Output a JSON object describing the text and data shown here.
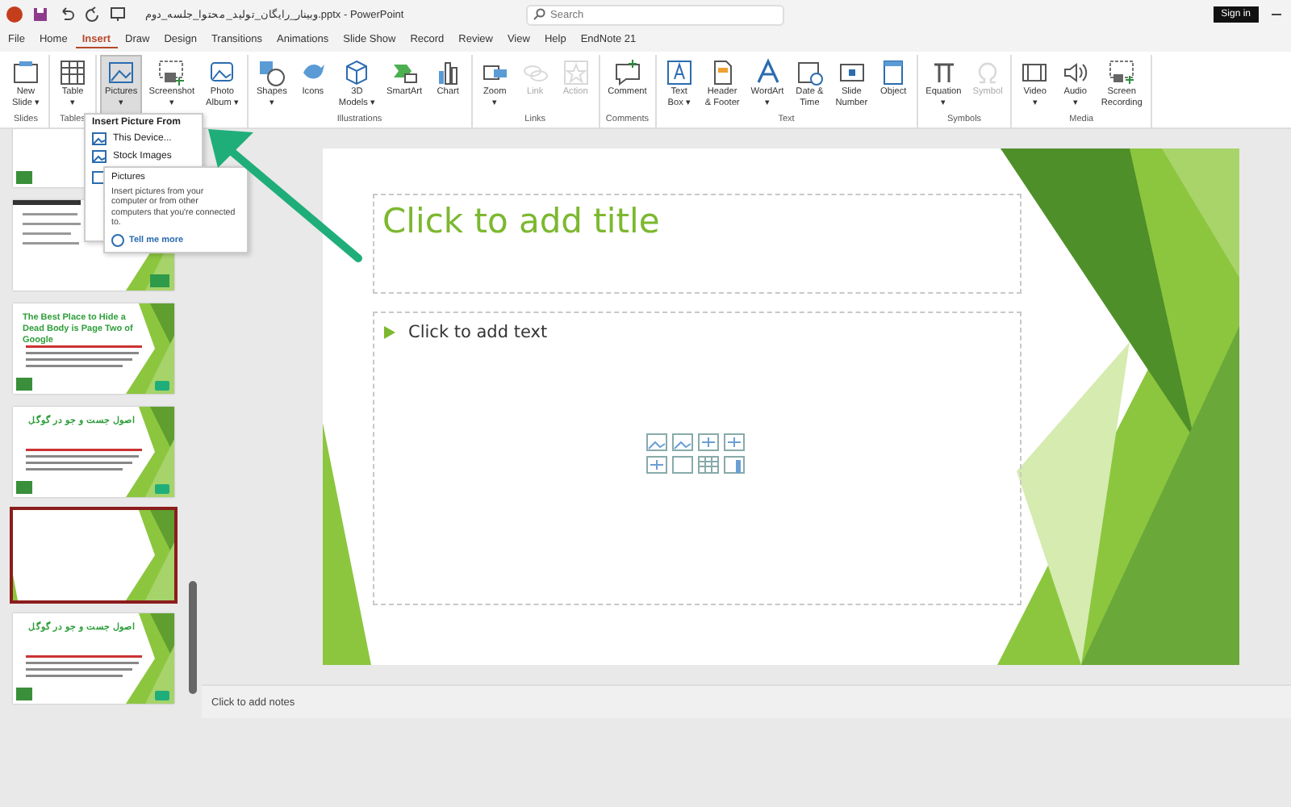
{
  "window": {
    "title": "وبینار_رایگان_تولید_محتوا_جلسه_دوم.pptx - PowerPoint",
    "search": {
      "placeholder": "Search"
    },
    "sign_in": "Sign in"
  },
  "tabs": [
    {
      "label": "File",
      "selected": false
    },
    {
      "label": "Home",
      "selected": false
    },
    {
      "label": "Insert",
      "selected": true
    },
    {
      "label": "Draw",
      "selected": false
    },
    {
      "label": "Design",
      "selected": false
    },
    {
      "label": "Transitions",
      "selected": false
    },
    {
      "label": "Animations",
      "selected": false
    },
    {
      "label": "Slide Show",
      "selected": false
    },
    {
      "label": "Record",
      "selected": false
    },
    {
      "label": "Review",
      "selected": false
    },
    {
      "label": "View",
      "selected": false
    },
    {
      "label": "Help",
      "selected": false
    },
    {
      "label": "EndNote 21",
      "selected": false
    }
  ],
  "ribbon": [
    {
      "label": "Slides",
      "buttons": [
        {
          "lines": [
            "New",
            "Slide ▾"
          ],
          "disabled": false,
          "pressed": false
        }
      ]
    },
    {
      "label": "Tables",
      "buttons": [
        {
          "lines": [
            "Table",
            "▾"
          ],
          "disabled": false,
          "pressed": false
        }
      ]
    },
    {
      "buttons": [
        {
          "lines": [
            "Pictures",
            "▾"
          ],
          "disabled": false,
          "pressed": true
        },
        {
          "lines": [
            "Screenshot",
            "▾"
          ],
          "disabled": false,
          "pressed": false
        },
        {
          "lines": [
            "Photo",
            "Album ▾"
          ],
          "disabled": false,
          "pressed": false
        }
      ]
    },
    {
      "label": "Illustrations",
      "buttons": [
        {
          "lines": [
            "Shapes",
            "▾"
          ],
          "disabled": false,
          "pressed": false
        },
        {
          "lines": [
            "Icons"
          ],
          "disabled": false,
          "pressed": false
        },
        {
          "lines": [
            "3D",
            "Models ▾"
          ],
          "disabled": false,
          "pressed": false
        },
        {
          "lines": [
            "SmartArt"
          ],
          "disabled": false,
          "pressed": false
        },
        {
          "lines": [
            "Chart"
          ],
          "disabled": false,
          "pressed": false
        }
      ]
    },
    {
      "label": "Links",
      "buttons": [
        {
          "lines": [
            "Zoom",
            "▾"
          ],
          "disabled": false,
          "pressed": false
        },
        {
          "lines": [
            "Link"
          ],
          "disabled": true,
          "pressed": false
        },
        {
          "lines": [
            "Action"
          ],
          "disabled": true,
          "pressed": false
        }
      ]
    },
    {
      "label": "Comments",
      "buttons": [
        {
          "lines": [
            "Comment"
          ],
          "disabled": false,
          "pressed": false
        }
      ]
    },
    {
      "label": "Text",
      "buttons": [
        {
          "lines": [
            "Text",
            "Box ▾"
          ],
          "disabled": false,
          "pressed": false
        },
        {
          "lines": [
            "Header",
            "& Footer"
          ],
          "disabled": false,
          "pressed": false
        },
        {
          "lines": [
            "WordArt",
            "▾"
          ],
          "disabled": false,
          "pressed": false
        },
        {
          "lines": [
            "Date &",
            "Time"
          ],
          "disabled": false,
          "pressed": false
        },
        {
          "lines": [
            "Slide",
            "Number"
          ],
          "disabled": false,
          "pressed": false
        },
        {
          "lines": [
            "Object"
          ],
          "disabled": false,
          "pressed": false
        }
      ]
    },
    {
      "label": "Symbols",
      "buttons": [
        {
          "lines": [
            "Equation",
            "▾"
          ],
          "disabled": false,
          "pressed": false
        },
        {
          "lines": [
            "Symbol"
          ],
          "disabled": true,
          "pressed": false
        }
      ]
    },
    {
      "label": "Media",
      "buttons": [
        {
          "lines": [
            "Video",
            "▾"
          ],
          "disabled": false,
          "pressed": false
        },
        {
          "lines": [
            "Audio",
            "▾"
          ],
          "disabled": false,
          "pressed": false
        },
        {
          "lines": [
            "Screen",
            "Recording"
          ],
          "disabled": false,
          "pressed": false
        }
      ]
    }
  ],
  "thumbnails": [
    {
      "kind": "logo",
      "selected": false
    },
    {
      "kind": "screenshot",
      "selected": false
    },
    {
      "kind": "content",
      "title": "The Best Place to Hide a Dead Body is Page Two of Google",
      "selected": false
    },
    {
      "kind": "content",
      "title": "اصول جست و جو در گوگل",
      "selected": false
    },
    {
      "kind": "blank",
      "selected": true
    },
    {
      "kind": "content",
      "title": "اصول جست و جو در گوگل",
      "selected": false
    }
  ],
  "slide": {
    "title_placeholder": "Click to add title",
    "body_placeholder": "Click to add text"
  },
  "notes_placeholder": "Click to add notes",
  "pictures_menu": {
    "header": "Insert Picture From",
    "items": [
      "This Device...",
      "Stock Images"
    ]
  },
  "tooltip": {
    "title": "Pictures",
    "text": "Insert pictures from your computer or from other computers that you're connected to.",
    "link": "Tell me more"
  }
}
